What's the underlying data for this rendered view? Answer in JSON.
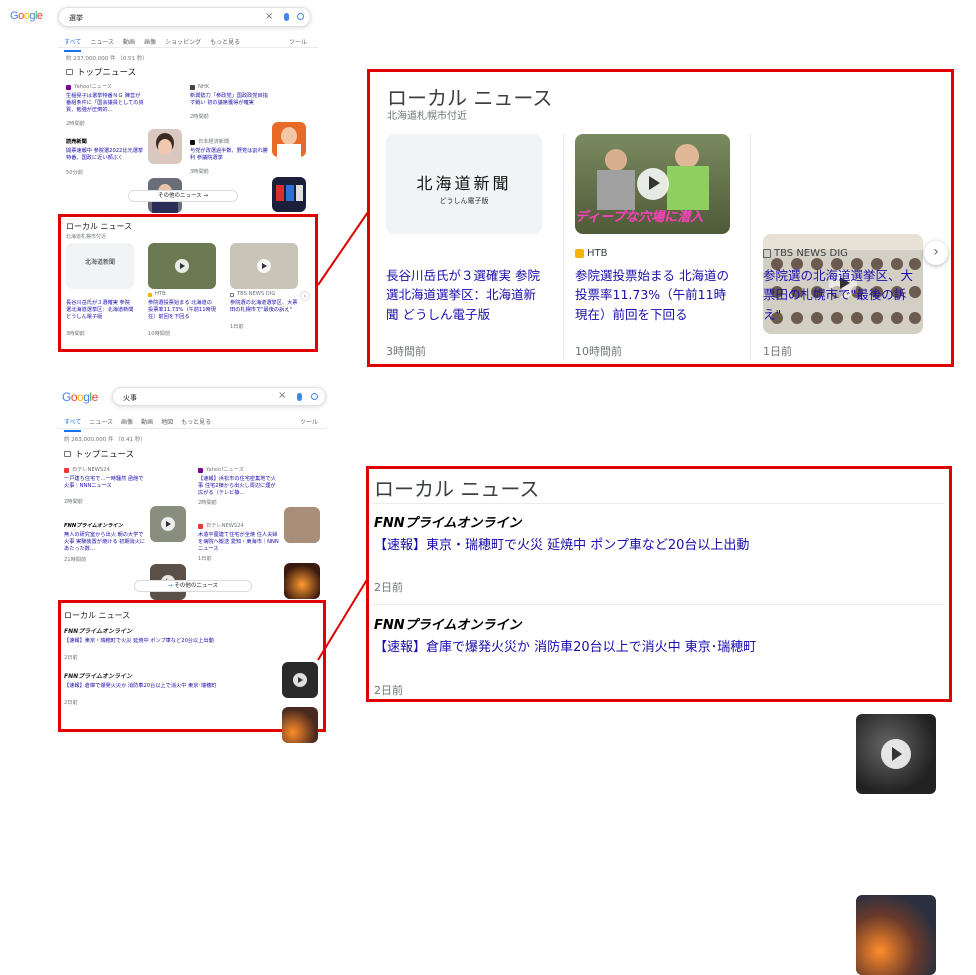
{
  "top": {
    "logo": "Google",
    "query": "選挙",
    "tabs": [
      "すべて",
      "ニュース",
      "動画",
      "画像",
      "ショッピング",
      "もっと見る",
      "ツール"
    ],
    "stats": "約 237,000,000 件 （0.51 秒）",
    "top_news_header": "トップニュース",
    "top_news": [
      {
        "source": "Yahoo!ニュース",
        "headline": "生稲晃子は選挙特番ＮＧ 陣営が番組条件に「国会議員としての資質、勉強が圧倒的…",
        "time": "2時間前"
      },
      {
        "source": "NHK",
        "headline": "新興勢力「参政党」国政政党目指す戦い 初の議席獲得が確実",
        "time": "2時間前"
      },
      {
        "source": "読売新聞",
        "headline": "開票速報中 参院選2022比元選挙特番、国政に近い顔ぶく",
        "time": "50分前"
      },
      {
        "source": "日本経済新聞",
        "headline": "与党が改選過半数、野党は割れ勝利 参議院選挙",
        "time": "3時間前"
      }
    ],
    "more_news": "その他のニュース →",
    "local_header": "ローカル ニュース",
    "local_location": "北海道札幌市付近",
    "local_news": [
      {
        "source": "北海道新聞",
        "headline": "長谷川岳氏が３選確実 参院選北海道選挙区：北海道新聞 どうしん電子版",
        "time": "3時間前"
      },
      {
        "source": "HTB",
        "headline": "参院選投票始まる 北海道の投票率11.73%（午前11時現在）前回を下回る",
        "time": "10時間前"
      },
      {
        "source": "TBS NEWS DIG",
        "headline": "参院選の北海道選挙区、大票田の札幌市で\"最後の訴え\"",
        "time": "1日前"
      }
    ]
  },
  "zoom_local": {
    "header": "ローカル ニュース",
    "location": "北海道札幌市付近",
    "paper_logo": "北海道新聞",
    "paper_sub": "どうしん電子版",
    "caption_text": "ディープな穴場に潜入",
    "cards": [
      {
        "source": "",
        "headline": "長谷川岳氏が３選確実 参院選北海道選挙区：北海道新聞 どうしん電子版",
        "time": "3時間前"
      },
      {
        "source": "HTB",
        "headline": "参院選投票始まる 北海道の投票率11.73%（午前11時現在）前回を下回る",
        "time": "10時間前"
      },
      {
        "source": "TBS NEWS DIG",
        "headline": "参院選の北海道選挙区、大票田の札幌市で\"最後の訴え\"",
        "time": "1日前"
      }
    ]
  },
  "bottom": {
    "logo": "Google",
    "query": "火事",
    "tabs": [
      "すべて",
      "ニュース",
      "画像",
      "動画",
      "地図",
      "もっと見る",
      "ツール"
    ],
    "stats": "約 263,000,000 件 （0.41 秒）",
    "top_news_header": "トップニュース",
    "top_news": [
      {
        "source": "日テレNEWS24",
        "headline": "一戸建ち住宅で…一時騒然 函館で火事｜NNNニュース",
        "time": "2時間前"
      },
      {
        "source": "Yahoo!ニュース",
        "headline": "【速報】浜松市の住宅密集地で火事 住宅2棟から出火し周辺に煙が広がる（テレビ静…",
        "time": "2時間前"
      },
      {
        "source": "FNNプライムオンライン",
        "headline": "無人の研究室から出火 朝の大学で火事 実験装置が焼ける 初期消火にあたった数…",
        "time": "21時間前"
      },
      {
        "source": "日テレNEWS24",
        "headline": "木造平屋建て住宅が全焼 住人夫婦を病院へ搬送 愛知・東海市｜NNNニュース",
        "time": "1日前"
      }
    ],
    "more_news": "その他のニュース",
    "local_header": "ローカル ニュース",
    "local_news": [
      {
        "source": "FNNプライムオンライン",
        "headline": "【速報】東京・瑞穂町で火災 延焼中 ポンプ車など20台以上出動",
        "time": "2日前"
      },
      {
        "source": "FNNプライムオンライン",
        "headline": "【速報】倉庫で爆発火災か 消防車20台以上で消火中 東京･瑞穂町",
        "time": "2日前"
      }
    ]
  },
  "zoom_fire": {
    "header": "ローカル ニュース",
    "items": [
      {
        "source": "FNNプライムオンライン",
        "headline": "【速報】東京・瑞穂町で火災 延焼中 ポンプ車など20台以上出動",
        "time": "2日前"
      },
      {
        "source": "FNNプライムオンライン",
        "headline": "【速報】倉庫で爆発火災か 消防車20台以上で消火中 東京･瑞穂町",
        "time": "2日前"
      }
    ]
  },
  "colors": {
    "red": "#e00000",
    "link": "#1a0dab",
    "accent": "#1a73e8"
  }
}
